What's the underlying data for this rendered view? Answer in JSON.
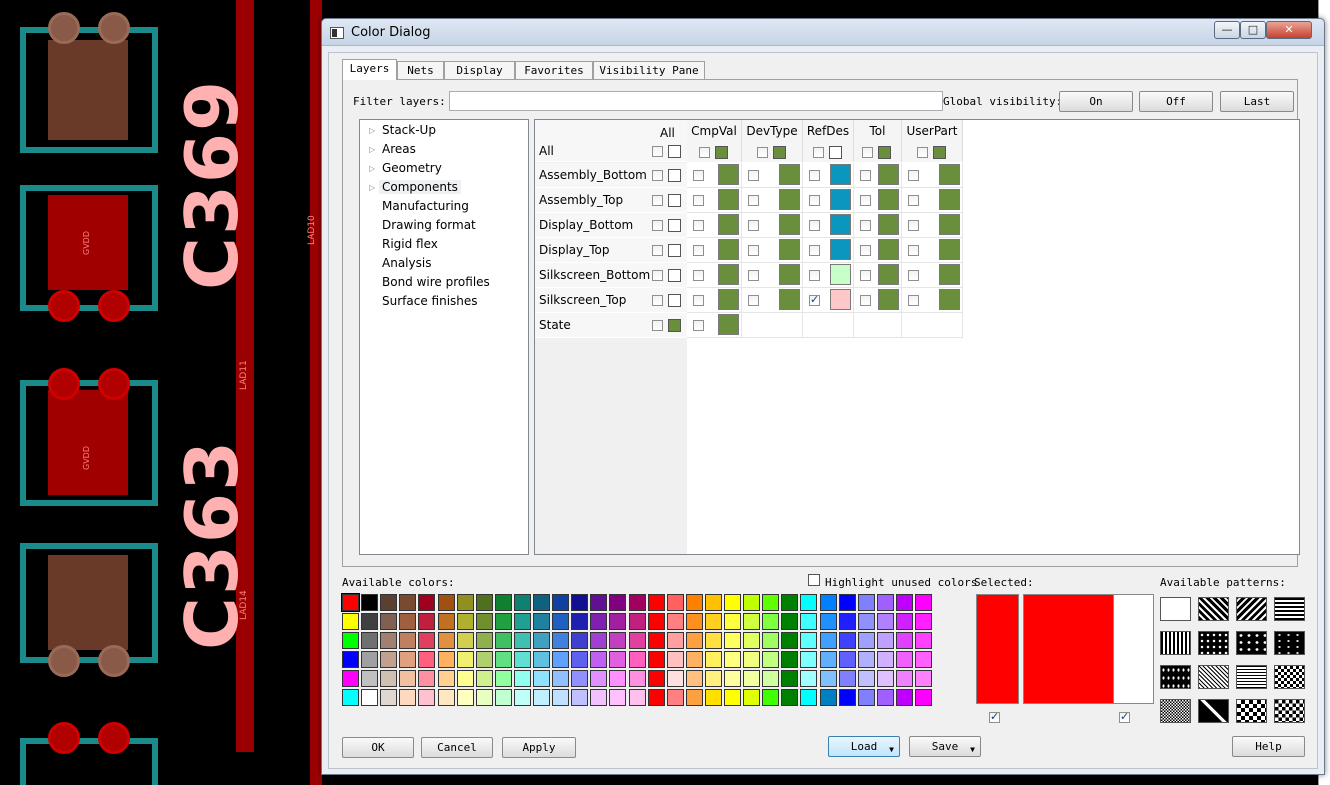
{
  "background": {
    "board_labels": [
      "C369",
      "C363",
      "GVDD",
      "GVDD",
      "LAD10",
      "LAD11",
      "LAD14"
    ]
  },
  "dialog": {
    "title": "Color Dialog",
    "window_buttons": {
      "minimize": "—",
      "maximize": "□",
      "close": "✕"
    },
    "tabs": [
      "Layers",
      "Nets",
      "Display",
      "Favorites",
      "Visibility Pane"
    ],
    "active_tab": "Layers",
    "filter_label": "Filter layers:",
    "filter_value": "",
    "global_visibility_label": "Global visibility:",
    "global_buttons": [
      "On",
      "Off",
      "Last"
    ],
    "tree": [
      {
        "label": "Stack-Up",
        "expandable": true
      },
      {
        "label": "Areas",
        "expandable": true
      },
      {
        "label": "Geometry",
        "expandable": true
      },
      {
        "label": "Components",
        "expandable": true,
        "selected": true
      },
      {
        "label": "Manufacturing",
        "expandable": false
      },
      {
        "label": "Drawing format",
        "expandable": false
      },
      {
        "label": "Rigid flex",
        "expandable": false
      },
      {
        "label": "Analysis",
        "expandable": false
      },
      {
        "label": "Bond wire profiles",
        "expandable": false
      },
      {
        "label": "Surface finishes",
        "expandable": false
      }
    ],
    "grid": {
      "all_col_label": "All",
      "all_row_label": "All",
      "columns": [
        "CmpVal",
        "DevType",
        "RefDes",
        "Tol",
        "UserPart"
      ],
      "rows": [
        {
          "label": "Assembly_Bottom",
          "checks": [
            false,
            false,
            false,
            false,
            false
          ],
          "colors": [
            "#6a8f3c",
            "#6a8f3c",
            "#0a96be",
            "#6a8f3c",
            "#6a8f3c"
          ]
        },
        {
          "label": "Assembly_Top",
          "checks": [
            false,
            false,
            false,
            false,
            false
          ],
          "colors": [
            "#6a8f3c",
            "#6a8f3c",
            "#0a96be",
            "#6a8f3c",
            "#6a8f3c"
          ]
        },
        {
          "label": "Display_Bottom",
          "checks": [
            false,
            false,
            false,
            false,
            false
          ],
          "colors": [
            "#6a8f3c",
            "#6a8f3c",
            "#0a96be",
            "#6a8f3c",
            "#6a8f3c"
          ]
        },
        {
          "label": "Display_Top",
          "checks": [
            false,
            false,
            false,
            false,
            false
          ],
          "colors": [
            "#6a8f3c",
            "#6a8f3c",
            "#0a96be",
            "#6a8f3c",
            "#6a8f3c"
          ]
        },
        {
          "label": "Silkscreen_Bottom",
          "checks": [
            false,
            false,
            false,
            false,
            false
          ],
          "colors": [
            "#6a8f3c",
            "#6a8f3c",
            "#c8ffc8",
            "#6a8f3c",
            "#6a8f3c"
          ]
        },
        {
          "label": "Silkscreen_Top",
          "checks": [
            false,
            false,
            true,
            false,
            false
          ],
          "colors": [
            "#6a8f3c",
            "#6a8f3c",
            "#ffc8c8",
            "#6a8f3c",
            "#6a8f3c"
          ]
        }
      ],
      "state_row_label": "State",
      "state_color": "#6a8f3c"
    },
    "available_colors_label": "Available colors:",
    "highlight_unused_label": "Highlight unused colors",
    "selected_label": "Selected:",
    "available_patterns_label": "Available patterns:",
    "palette_rows": [
      [
        "#ff0000",
        "#000000",
        "#5a4030",
        "#7a4a30",
        "#a00020",
        "#a05010",
        "#909020",
        "#507020",
        "#108030",
        "#108070",
        "#106080",
        "#1040a0",
        "#101090",
        "#601090",
        "#800080",
        "#a00060",
        "#ff0000",
        "#ff6060",
        "#ff8000",
        "#ffc000",
        "#ffff00",
        "#c0ff00",
        "#60ff00",
        "#008000",
        "#00ffff",
        "#0080ff",
        "#0000ff",
        "#8080ff",
        "#a060ff",
        "#c000ff",
        "#ff00ff"
      ],
      [
        "#ffff00",
        "#404040",
        "#806050",
        "#a06040",
        "#c02040",
        "#c07020",
        "#b0b030",
        "#709030",
        "#20a040",
        "#20a090",
        "#2080a0",
        "#2060c0",
        "#2020b0",
        "#8020b0",
        "#a020a0",
        "#c02080",
        "#ff0000",
        "#ff8080",
        "#ff9020",
        "#ffd020",
        "#ffff40",
        "#d0ff40",
        "#80ff40",
        "#008000",
        "#40ffff",
        "#2090ff",
        "#2020ff",
        "#9090ff",
        "#b080ff",
        "#d020ff",
        "#ff20ff"
      ],
      [
        "#00ff00",
        "#707070",
        "#a08070",
        "#c08060",
        "#e04060",
        "#e09040",
        "#d0d050",
        "#90b050",
        "#40c060",
        "#40c0b0",
        "#40a0c0",
        "#4080e0",
        "#4040d0",
        "#a040d0",
        "#c040c0",
        "#e040a0",
        "#ff0000",
        "#ffa0a0",
        "#ffa040",
        "#ffe040",
        "#ffff60",
        "#e0ff60",
        "#a0ff60",
        "#008000",
        "#60ffff",
        "#40a0ff",
        "#4040ff",
        "#a0a0ff",
        "#c0a0ff",
        "#e040ff",
        "#ff40ff"
      ],
      [
        "#0000ff",
        "#a0a0a0",
        "#c0a090",
        "#e0a080",
        "#ff6080",
        "#ffb060",
        "#f0f070",
        "#b0d070",
        "#60e080",
        "#60e0d0",
        "#60c0e0",
        "#60a0ff",
        "#6060f0",
        "#c060f0",
        "#e060e0",
        "#ff60c0",
        "#ff0000",
        "#ffc0c0",
        "#ffb060",
        "#fff060",
        "#ffff80",
        "#f0ff80",
        "#c0ff80",
        "#008000",
        "#80ffff",
        "#60b0ff",
        "#6060ff",
        "#b0b0ff",
        "#d0b0ff",
        "#f060ff",
        "#ff60ff"
      ],
      [
        "#ff00ff",
        "#c0c0c0",
        "#d0c0b0",
        "#f0c0a0",
        "#ff90a0",
        "#ffd090",
        "#ffff90",
        "#d0f090",
        "#90ffa0",
        "#90fff0",
        "#90e0ff",
        "#90c0ff",
        "#9090ff",
        "#e090ff",
        "#ff90ff",
        "#ff90e0",
        "#ff0000",
        "#ffe0e0",
        "#ffc080",
        "#fff080",
        "#ffffa0",
        "#f0ffa0",
        "#d0ffa0",
        "#008000",
        "#a0ffff",
        "#80c0ff",
        "#8080ff",
        "#c0c0ff",
        "#e0c0ff",
        "#f080ff",
        "#ff80ff"
      ],
      [
        "#00ffff",
        "#ffffff",
        "#e0d8d0",
        "#ffd8c0",
        "#ffc0d0",
        "#ffe8c0",
        "#ffffc0",
        "#e8ffc0",
        "#c0ffd0",
        "#c0fff8",
        "#c0f0ff",
        "#c0e0ff",
        "#c0c0ff",
        "#f0c0ff",
        "#ffc0ff",
        "#ffc0f0",
        "#ff0000",
        "#ff8080",
        "#ffa040",
        "#ffe000",
        "#ffff00",
        "#e0ff00",
        "#40ff00",
        "#008000",
        "#00ffff",
        "#0080c0",
        "#0000ff",
        "#8080ff",
        "#a060ff",
        "#c000ff",
        "#ff00ff"
      ]
    ],
    "selected_color": "#ff0000",
    "selected_checks": [
      true,
      true
    ],
    "buttons": {
      "ok": "OK",
      "cancel": "Cancel",
      "apply": "Apply",
      "load": "Load",
      "save": "Save",
      "help": "Help"
    }
  }
}
